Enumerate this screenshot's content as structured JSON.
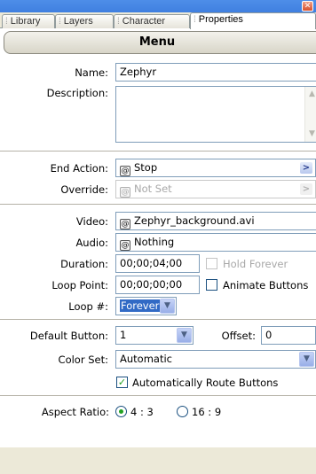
{
  "window": {
    "close_glyph": "✕"
  },
  "tabs": [
    {
      "label": "Library",
      "active": false
    },
    {
      "label": "Layers",
      "active": false
    },
    {
      "label": "Character",
      "active": false
    },
    {
      "label": "Properties",
      "active": true
    }
  ],
  "header": {
    "title": "Menu"
  },
  "fields": {
    "name": {
      "label": "Name:",
      "value": "Zephyr"
    },
    "description": {
      "label": "Description:",
      "value": ""
    },
    "end_action": {
      "label": "End Action:",
      "value": "Stop"
    },
    "override": {
      "label": "Override:",
      "value": "Not Set"
    },
    "video": {
      "label": "Video:",
      "value": "Zephyr_background.avi"
    },
    "audio": {
      "label": "Audio:",
      "value": "Nothing"
    },
    "duration": {
      "label": "Duration:",
      "value": "00;00;04;00"
    },
    "hold_forever": {
      "label": "Hold Forever",
      "checked": false,
      "enabled": false
    },
    "loop_point": {
      "label": "Loop Point:",
      "value": "00;00;00;00"
    },
    "animate_buttons": {
      "label": "Animate Buttons",
      "checked": false,
      "enabled": true
    },
    "loop_count": {
      "label": "Loop #:",
      "value": "Forever"
    },
    "default_button": {
      "label": "Default Button:",
      "value": "1"
    },
    "offset": {
      "label": "Offset:",
      "value": "0"
    },
    "color_set": {
      "label": "Color Set:",
      "value": "Automatic"
    },
    "auto_route": {
      "label": "Automatically Route Buttons",
      "checked": true,
      "enabled": true
    },
    "aspect_ratio": {
      "label": "Aspect Ratio:",
      "options": [
        "4 : 3",
        "16 : 9"
      ],
      "selected": "4 : 3"
    }
  },
  "icons": {
    "link": "@",
    "arrow_right": ">",
    "dropdown": "▼",
    "check": "✓",
    "scroll_up": "▲",
    "scroll_down": "▼"
  }
}
